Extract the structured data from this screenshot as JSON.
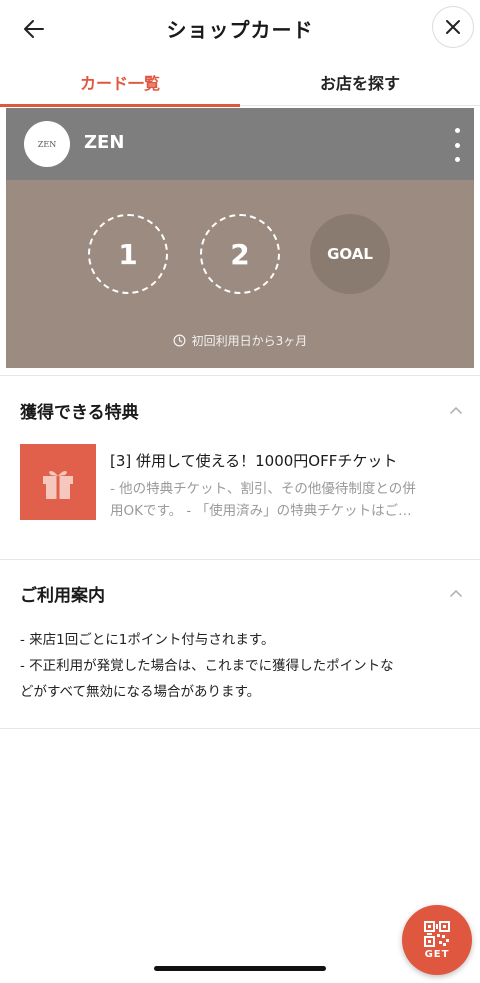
{
  "header": {
    "title": "ショップカード"
  },
  "tabs": [
    {
      "label": "カード一覧",
      "active": true
    },
    {
      "label": "お店を探す",
      "active": false
    }
  ],
  "card": {
    "logo_text": "ZEN",
    "shop_name": "ZEN",
    "stamps": [
      "1",
      "2"
    ],
    "goal_label": "GOAL",
    "validity": "初回利用日から3ヶ月",
    "colors": {
      "card_bg": "#9b8b80",
      "card_head": "#7e7e7e"
    }
  },
  "benefits": {
    "section_title": "獲得できる特典",
    "items": [
      {
        "title": "[3] 併用して使える！1000円OFFチケット",
        "desc_line1": "- 他の特典チケット、割引、その他優待制度との併",
        "desc_line2": "用OKです。 - 「使用済み」の特典チケットはご…"
      }
    ]
  },
  "usage": {
    "section_title": "ご利用案内",
    "line1": "- 来店1回ごとに1ポイント付与されます。",
    "line2": "- 不正利用が発覚した場合は、これまでに獲得したポイントな",
    "line3": "どがすべて無効になる場合があります。"
  },
  "fab": {
    "label": "GET"
  },
  "accent_color": "#e0573f"
}
